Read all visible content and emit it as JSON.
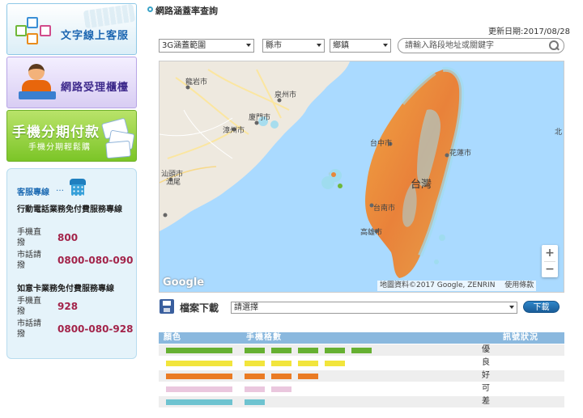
{
  "sidebar": {
    "banner_chat": {
      "label": "文字線上客服"
    },
    "banner_counter": {
      "label": "網路受理櫃檯"
    },
    "banner_installment": {
      "label": "手機分期付款",
      "sub": "手機分期輕鬆購"
    },
    "service": {
      "title": "客服專線",
      "dots": "…",
      "groups": [
        {
          "title": "行動電話業務免付費服務專線",
          "rows": [
            {
              "key": "手機直撥",
              "value": "800"
            },
            {
              "key": "市話請撥",
              "value": "0800-080-090"
            }
          ]
        },
        {
          "title": "如意卡業務免付費服務專線",
          "rows": [
            {
              "key": "手機直撥",
              "value": "928"
            },
            {
              "key": "市話請撥",
              "value": "0800-080-928"
            }
          ]
        }
      ]
    }
  },
  "main": {
    "title": "網路涵蓋率查詢",
    "update": "更新日期:2017/08/28",
    "filters": {
      "coverage": "3G涵蓋範圍",
      "county": "縣市",
      "township": "鄉鎮",
      "search_placeholder": "請輸入路段地址或關鍵字"
    },
    "map": {
      "labels": {
        "longyan": "龍岩市",
        "quanzhou": "泉州市",
        "xiamen": "廈門市",
        "zhangzhou": "漳州市",
        "shantou": "汕頭市",
        "shanwei": "汕尾",
        "taichung": "台中市",
        "hualien": "花蓮市",
        "taiwan": "台灣",
        "tainan": "台南市",
        "kaohsiung": "高雄市",
        "bei": "北"
      },
      "logo": "Google",
      "attribution": "地圖資料©2017 Google, ZENRIN",
      "terms": "使用條款",
      "zoom_in": "+",
      "zoom_out": "−"
    },
    "download": {
      "label": "檔案下載",
      "select": "請選擇",
      "button": "下載"
    },
    "legend": {
      "headers": {
        "color": "顏色",
        "bars": "手機格數",
        "status": "訊號狀況"
      },
      "rows": [
        {
          "name": "優",
          "color": "#66b032",
          "bars": 5
        },
        {
          "name": "良",
          "color": "#f2e53c",
          "bars": 4
        },
        {
          "name": "好",
          "color": "#ea7b24",
          "bars": 3
        },
        {
          "name": "可",
          "color": "#eac7de",
          "bars": 2
        },
        {
          "name": "差",
          "color": "#6ec3d0",
          "bars": 1
        }
      ]
    }
  }
}
